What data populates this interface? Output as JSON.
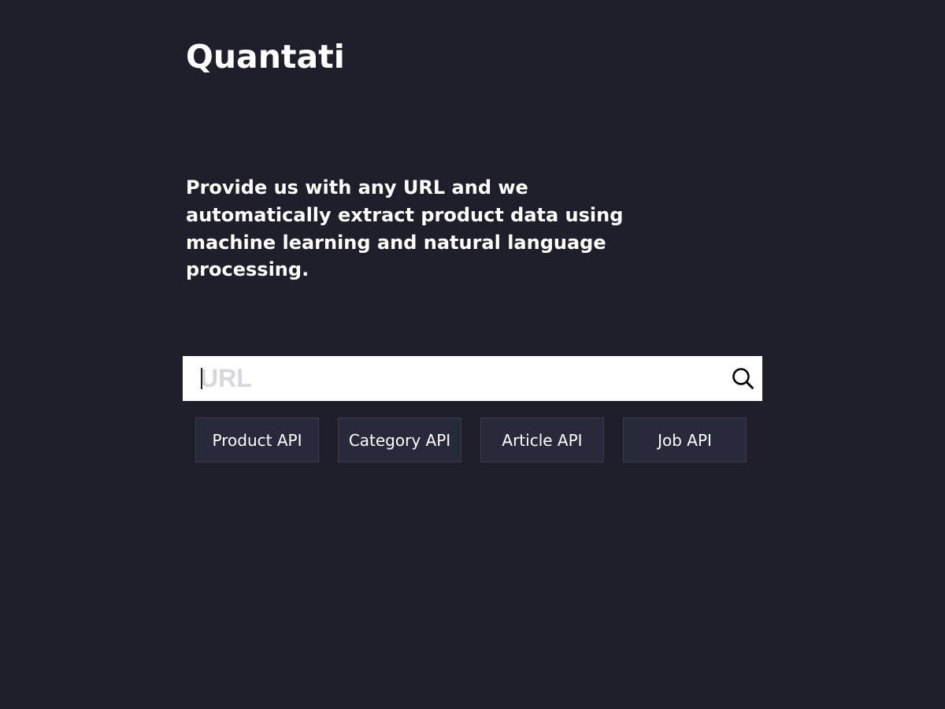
{
  "brand": {
    "name": "Quantati"
  },
  "hero": {
    "description": "Provide us with any URL and we automatically extract product data using machine learning and natural language processing."
  },
  "search": {
    "placeholder": "URL",
    "value": "",
    "icon": "search-icon"
  },
  "api_buttons": [
    {
      "label": "Product API"
    },
    {
      "label": "Category API"
    },
    {
      "label": "Article API"
    },
    {
      "label": "Job API"
    }
  ],
  "colors": {
    "background": "#1e1f2a",
    "button_background": "#272a3b",
    "button_border": "#3a3d4f",
    "text": "#ffffff",
    "placeholder": "#d6d6dc"
  }
}
